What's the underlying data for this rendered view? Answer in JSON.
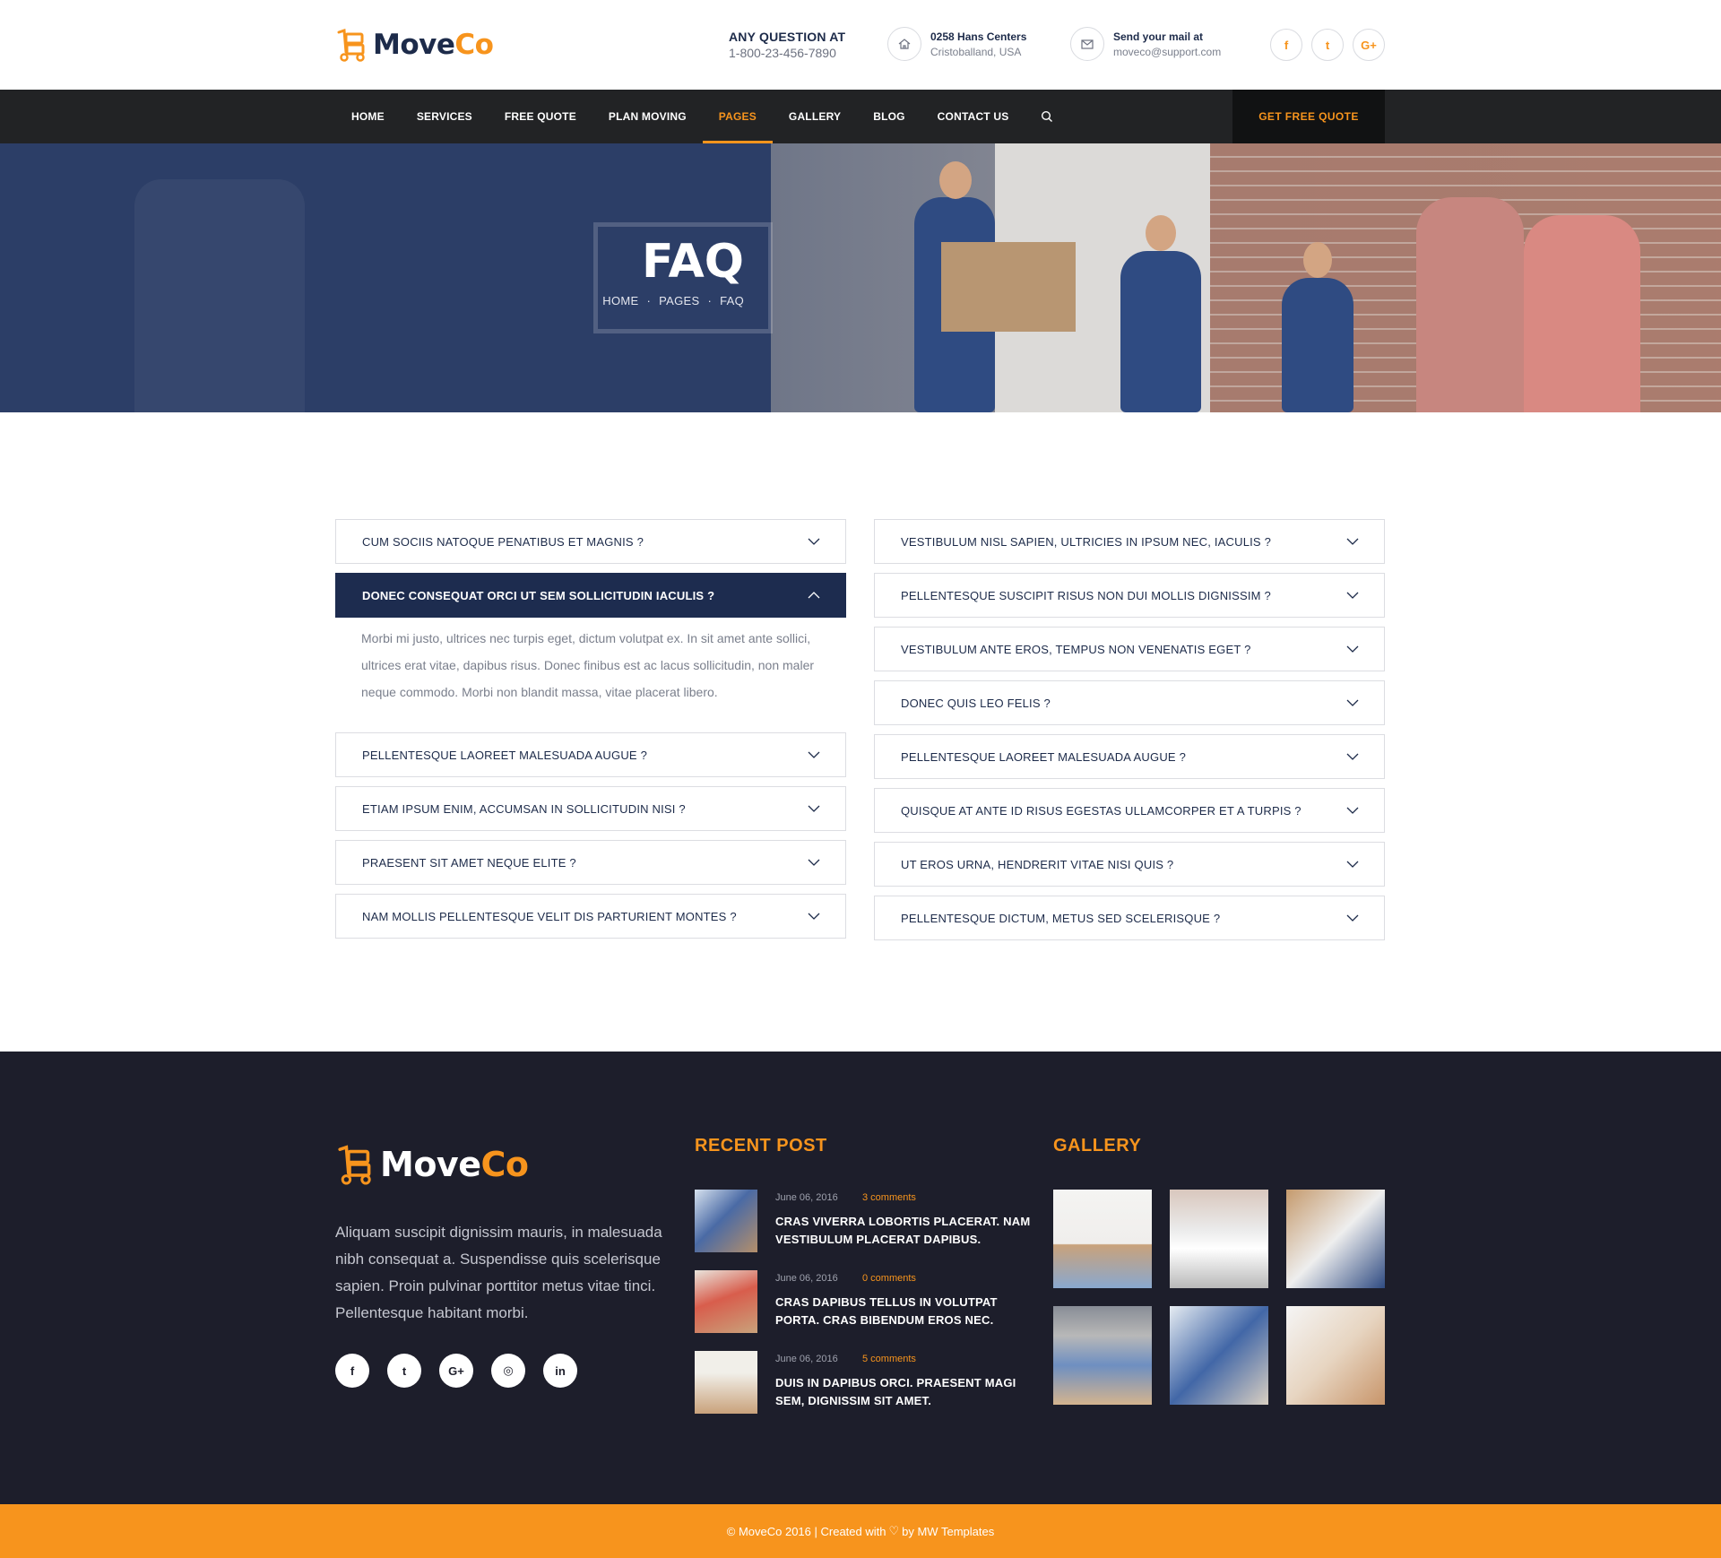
{
  "brand": {
    "name_part1": "Move",
    "name_part2": "Co",
    "primary": "#1d2b4a",
    "accent": "#f7941d"
  },
  "header": {
    "question_label": "ANY QUESTION AT",
    "phone": "1-800-23-456-7890",
    "address": {
      "icon": "home-icon",
      "line1": "0258 Hans Centers",
      "line2": "Cristoballand, USA"
    },
    "mail": {
      "icon": "mail-icon",
      "line1": "Send your mail at",
      "line2": "moveco@support.com"
    },
    "social": [
      {
        "icon": "facebook-icon",
        "glyph": "f"
      },
      {
        "icon": "twitter-icon",
        "glyph": "t"
      },
      {
        "icon": "google-plus-icon",
        "glyph": "G+"
      }
    ]
  },
  "nav": {
    "items": [
      "HOME",
      "SERVICES",
      "FREE QUOTE",
      "PLAN MOVING",
      "PAGES",
      "GALLERY",
      "BLOG",
      "CONTACT US"
    ],
    "active_index": 4,
    "cta": "GET FREE QUOTE"
  },
  "hero": {
    "title": "FAQ",
    "breadcrumb": [
      "HOME",
      "PAGES",
      "FAQ"
    ],
    "separator": "·"
  },
  "faq": {
    "left": [
      {
        "q": "CUM SOCIIS NATOQUE PENATIBUS ET MAGNIS ?",
        "open": false
      },
      {
        "q": "DONEC CONSEQUAT ORCI UT SEM SOLLICITUDIN IACULIS ?",
        "open": true,
        "a": "Morbi mi justo, ultrices nec turpis eget, dictum volutpat ex. In sit amet ante sollici, ultrices erat vitae, dapibus risus. Donec finibus est ac lacus sollicitudin, non maler neque commodo. Morbi non blandit massa, vitae placerat libero."
      },
      {
        "q": "PELLENTESQUE LAOREET MALESUADA AUGUE ?",
        "open": false
      },
      {
        "q": "ETIAM IPSUM ENIM, ACCUMSAN IN SOLLICITUDIN NISI ?",
        "open": false
      },
      {
        "q": "PRAESENT SIT AMET NEQUE ELITE ?",
        "open": false
      },
      {
        "q": "NAM MOLLIS PELLENTESQUE VELIT DIS PARTURIENT MONTES ?",
        "open": false
      }
    ],
    "right": [
      {
        "q": "VESTIBULUM NISL SAPIEN, ULTRICIES IN IPSUM NEC, IACULIS ?",
        "open": false
      },
      {
        "q": "PELLENTESQUE SUSCIPIT RISUS NON DUI MOLLIS DIGNISSIM ?",
        "open": false
      },
      {
        "q": "VESTIBULUM ANTE EROS, TEMPUS NON VENENATIS EGET ?",
        "open": false
      },
      {
        "q": "DONEC QUIS LEO FELIS ?",
        "open": false
      },
      {
        "q": "PELLENTESQUE LAOREET MALESUADA AUGUE ?",
        "open": false
      },
      {
        "q": "QUISQUE AT ANTE ID RISUS EGESTAS ULLAMCORPER ET A TURPIS ?",
        "open": false
      },
      {
        "q": "UT EROS URNA, HENDRERIT VITAE NISI QUIS ?",
        "open": false
      },
      {
        "q": "PELLENTESQUE DICTUM, METUS SED SCELERISQUE ?",
        "open": false
      }
    ]
  },
  "footer": {
    "about": "Aliquam suscipit dignissim mauris, in malesuada nibh consequat a. Suspendisse quis scelerisque sapien. Proin pulvinar porttitor metus vitae tinci. Pellentesque habitant morbi.",
    "social": [
      {
        "icon": "facebook-icon",
        "glyph": "f"
      },
      {
        "icon": "twitter-icon",
        "glyph": "t"
      },
      {
        "icon": "google-plus-icon",
        "glyph": "G+"
      },
      {
        "icon": "instagram-icon",
        "glyph": "◎"
      },
      {
        "icon": "linkedin-icon",
        "glyph": "in"
      }
    ],
    "recent_heading": "RECENT POST",
    "posts": [
      {
        "date": "June 06, 2016",
        "comments": "3 comments",
        "title": "CRAS VIVERRA LOBORTIS PLACERAT. NAM VESTIBULUM PLACERAT DAPIBUS."
      },
      {
        "date": "June 06, 2016",
        "comments": "0 comments",
        "title": "CRAS DAPIBUS TELLUS IN VOLUTPAT PORTA. CRAS BIBENDUM EROS NEC."
      },
      {
        "date": "June 06, 2016",
        "comments": "5 comments",
        "title": "DUIS IN DAPIBUS ORCI. PRAESENT MAGI SEM, DIGNISSIM SIT AMET."
      }
    ],
    "gallery_heading": "GALLERY"
  },
  "copyright": {
    "before": "© MoveCo 2016 | Created with",
    "heart": "♡",
    "after": "by MW Templates"
  }
}
